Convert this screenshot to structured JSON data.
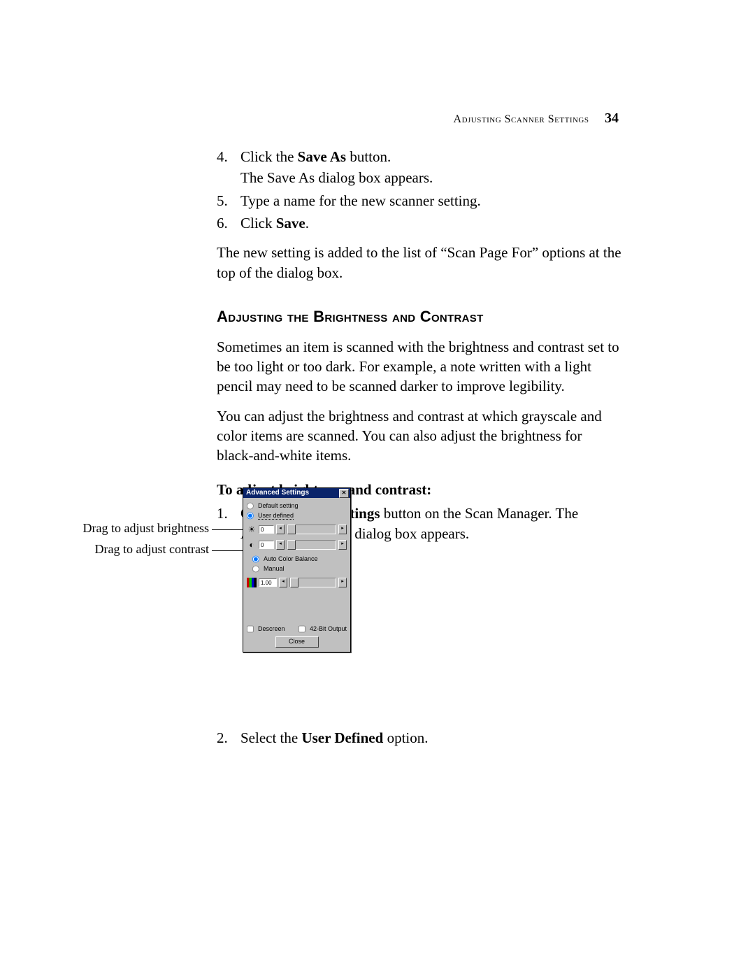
{
  "header": {
    "running_head": "Adjusting Scanner Settings",
    "page_number": "34"
  },
  "steps_top": [
    {
      "n": "4.",
      "text_pre": "Click the ",
      "bold": "Save As",
      "text_post": " button.",
      "cont": "The Save As dialog box appears."
    },
    {
      "n": "5.",
      "text_pre": "Type a name for the new scanner setting.",
      "bold": "",
      "text_post": "",
      "cont": ""
    },
    {
      "n": "6.",
      "text_pre": "Click ",
      "bold": "Save",
      "text_post": ".",
      "cont": ""
    }
  ],
  "para_after_steps": "The new setting is added to the list of “Scan Page For” options at the top of the dialog box.",
  "section_heading": "Adjusting the Brightness and Contrast",
  "para1": "Sometimes an item is scanned with the brightness and contrast set to be too light or too dark. For example, a note written with a light pencil may need to be scanned darker to improve legibility.",
  "para2": "You can adjust the brightness and contrast at which grayscale and color items are scanned. You can also adjust the brightness for black-and-white items.",
  "subhead": "To adjust brightness and contrast:",
  "steps_bottom": [
    {
      "n": "1.",
      "text_pre": "Click the ",
      "bold": "Adv. Settings",
      "text_post": " button on the Scan Manager. The Advanced Settings dialog box appears."
    },
    {
      "n": "2.",
      "text_pre": "Select the ",
      "bold": "User Defined",
      "text_post": " option."
    }
  ],
  "callouts": {
    "brightness": "Drag to adjust brightness",
    "contrast": "Drag to adjust contrast"
  },
  "dialog": {
    "title": "Advanced Settings",
    "opt_default": "Default setting",
    "opt_user": "User defined",
    "brightness_value": "0",
    "contrast_value": "0",
    "opt_auto_color": "Auto Color Balance",
    "opt_manual": "Manual",
    "gamma_value": "1.00",
    "chk_descreen": "Descreen",
    "chk_42bit": "42-Bit Output",
    "btn_close": "Close"
  }
}
